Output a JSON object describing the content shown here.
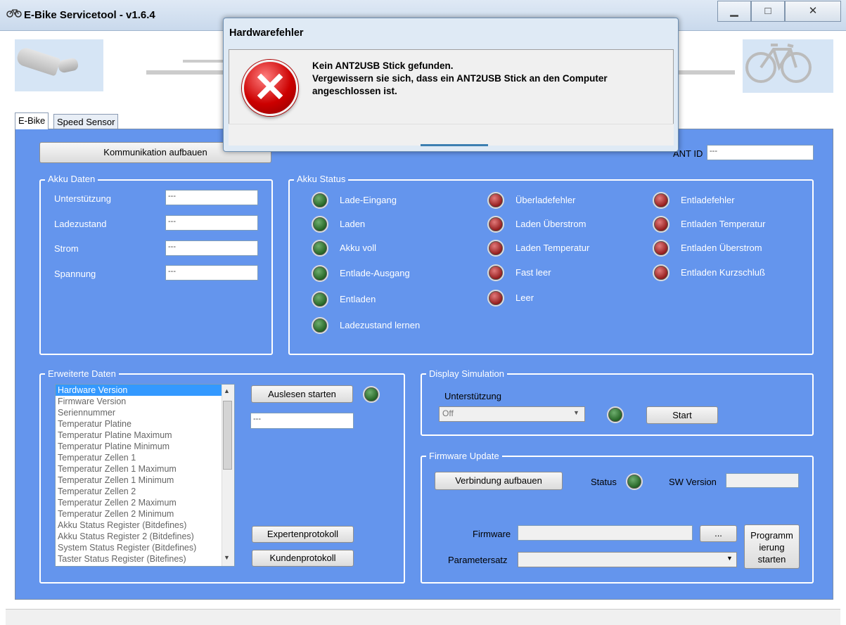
{
  "window": {
    "title": "E-Bike Servicetool - v1.6.4",
    "minimize": "▁",
    "maximize": "□",
    "close": "✕",
    "app_icon": "bicycle-icon"
  },
  "tabs": [
    "E-Bike",
    "Speed Sensor"
  ],
  "connect_button": "Kommunikation aufbauen",
  "ant_id": {
    "label": "ANT ID",
    "value": "---"
  },
  "akku_daten": {
    "title": "Akku Daten",
    "rows": [
      {
        "label": "Unterstützung",
        "value": "---"
      },
      {
        "label": "Ladezustand",
        "value": "---"
      },
      {
        "label": "Strom",
        "value": "---"
      },
      {
        "label": "Spannung",
        "value": "---"
      }
    ]
  },
  "akku_status": {
    "title": "Akku Status",
    "col1": [
      "Lade-Eingang",
      "Laden",
      "Akku voll",
      "Entlade-Ausgang",
      "Entladen",
      "Ladezustand lernen"
    ],
    "col2": [
      "Überladefehler",
      "Laden Überstrom",
      "Laden Temperatur",
      "Fast leer",
      "Leer"
    ],
    "col3": [
      "Entladefehler",
      "Entladen Temperatur",
      "Entladen Überstrom",
      "Entladen Kurzschluß"
    ],
    "colors": {
      "ok": "#2e7d32",
      "error": "#b71c1c"
    }
  },
  "erweiterte_daten": {
    "title": "Erweiterte Daten",
    "items": [
      "Hardware Version",
      "Firmware Version",
      "Seriennummer",
      "Temperatur Platine",
      "Temperatur Platine Maximum",
      "Temperatur Platine Minimum",
      "Temperatur Zellen 1",
      "Temperatur Zellen 1 Maximum",
      "Temperatur Zellen 1 Minimum",
      "Temperatur Zellen 2",
      "Temperatur Zellen 2 Maximum",
      "Temperatur Zellen 2 Minimum",
      "Akku Status Register (Bitdefines)",
      "Akku Status Register 2 (Bitdefines)",
      "System Status Register (Bitdefines)",
      "Taster Status Register (Bitefines)"
    ],
    "read_button": "Auslesen starten",
    "value": "---",
    "expert_button": "Expertenprotokoll",
    "customer_button": "Kundenprotokoll"
  },
  "display_sim": {
    "title": "Display Simulation",
    "label": "Unterstützung",
    "selected": "Off",
    "start_button": "Start"
  },
  "firmware_update": {
    "title": "Firmware Update",
    "connect_button": "Verbindung aufbauen",
    "status_label": "Status",
    "sw_version_label": "SW Version",
    "sw_version": "",
    "firmware_label": "Firmware",
    "firmware_path": "",
    "browse_button": "...",
    "parameter_label": "Parametersatz",
    "parameter_value": "",
    "program_button": "Programm ierung starten"
  },
  "dialog": {
    "title": "Hardwarefehler",
    "line1": "Kein ANT2USB Stick gefunden.",
    "line2": "Vergewissern sie sich, dass ein ANT2USB Stick an den Computer",
    "line3": "angeschlossen ist.",
    "icon": "error-icon"
  }
}
